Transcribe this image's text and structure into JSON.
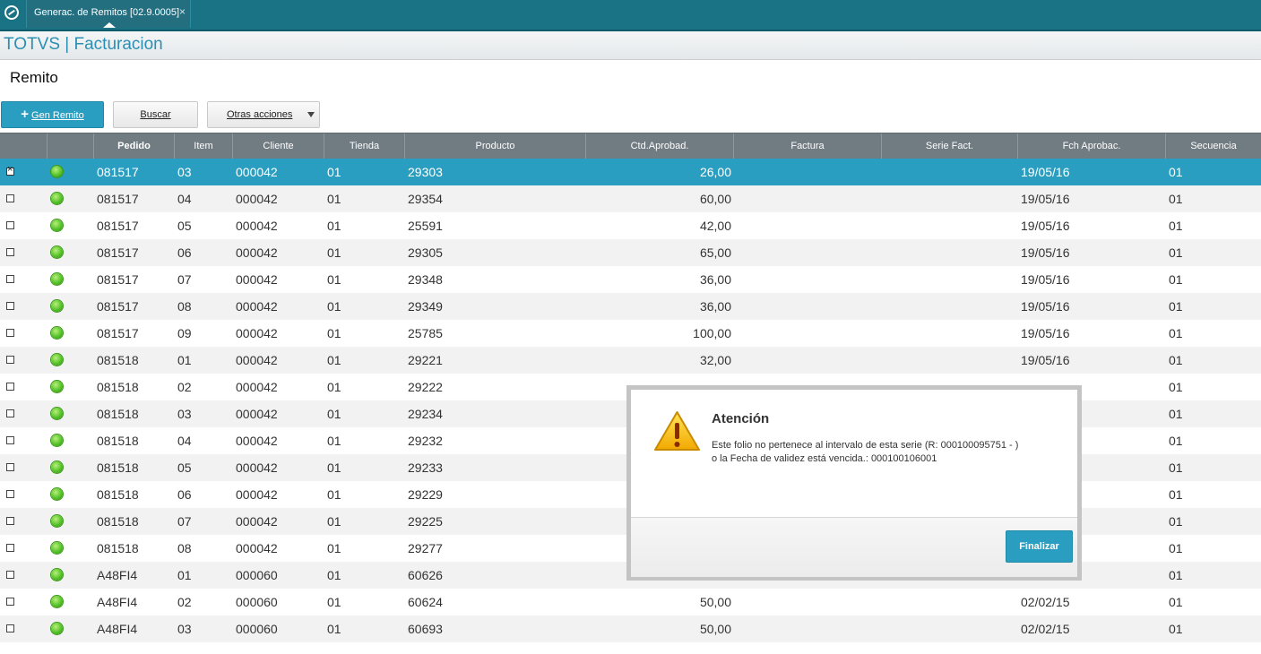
{
  "window": {
    "tab_label": "Generac. de Remitos [02.9.0005]",
    "tab_close": "×",
    "app_title": "TOTVS | Facturacion"
  },
  "page": {
    "title": "Remito"
  },
  "toolbar": {
    "gen_remito": "Gen Remito",
    "gen_remito_plus": "+",
    "buscar": "Buscar",
    "otras_acciones": "Otras acciones"
  },
  "grid": {
    "columns": [
      "",
      "",
      "Pedido",
      "Item",
      "Cliente",
      "Tienda",
      "Producto",
      "Ctd.Aprobad.",
      "Factura",
      "Serie Fact.",
      "Fch Aprobac.",
      "Secuencia"
    ],
    "rows": [
      {
        "pedido": "081517",
        "item": "03",
        "cliente": "000042",
        "tienda": "01",
        "producto": "29303",
        "ctd": "26,00",
        "factura": "",
        "serie": "",
        "fecha": "19/05/16",
        "secuencia": "01"
      },
      {
        "pedido": "081517",
        "item": "04",
        "cliente": "000042",
        "tienda": "01",
        "producto": "29354",
        "ctd": "60,00",
        "factura": "",
        "serie": "",
        "fecha": "19/05/16",
        "secuencia": "01"
      },
      {
        "pedido": "081517",
        "item": "05",
        "cliente": "000042",
        "tienda": "01",
        "producto": "25591",
        "ctd": "42,00",
        "factura": "",
        "serie": "",
        "fecha": "19/05/16",
        "secuencia": "01"
      },
      {
        "pedido": "081517",
        "item": "06",
        "cliente": "000042",
        "tienda": "01",
        "producto": "29305",
        "ctd": "65,00",
        "factura": "",
        "serie": "",
        "fecha": "19/05/16",
        "secuencia": "01"
      },
      {
        "pedido": "081517",
        "item": "07",
        "cliente": "000042",
        "tienda": "01",
        "producto": "29348",
        "ctd": "36,00",
        "factura": "",
        "serie": "",
        "fecha": "19/05/16",
        "secuencia": "01"
      },
      {
        "pedido": "081517",
        "item": "08",
        "cliente": "000042",
        "tienda": "01",
        "producto": "29349",
        "ctd": "36,00",
        "factura": "",
        "serie": "",
        "fecha": "19/05/16",
        "secuencia": "01"
      },
      {
        "pedido": "081517",
        "item": "09",
        "cliente": "000042",
        "tienda": "01",
        "producto": "25785",
        "ctd": "100,00",
        "factura": "",
        "serie": "",
        "fecha": "19/05/16",
        "secuencia": "01"
      },
      {
        "pedido": "081518",
        "item": "01",
        "cliente": "000042",
        "tienda": "01",
        "producto": "29221",
        "ctd": "32,00",
        "factura": "",
        "serie": "",
        "fecha": "19/05/16",
        "secuencia": "01"
      },
      {
        "pedido": "081518",
        "item": "02",
        "cliente": "000042",
        "tienda": "01",
        "producto": "29222",
        "ctd": "",
        "factura": "",
        "serie": "",
        "fecha": "",
        "secuencia": "01"
      },
      {
        "pedido": "081518",
        "item": "03",
        "cliente": "000042",
        "tienda": "01",
        "producto": "29234",
        "ctd": "",
        "factura": "",
        "serie": "",
        "fecha": "",
        "secuencia": "01"
      },
      {
        "pedido": "081518",
        "item": "04",
        "cliente": "000042",
        "tienda": "01",
        "producto": "29232",
        "ctd": "",
        "factura": "",
        "serie": "",
        "fecha": "",
        "secuencia": "01"
      },
      {
        "pedido": "081518",
        "item": "05",
        "cliente": "000042",
        "tienda": "01",
        "producto": "29233",
        "ctd": "",
        "factura": "",
        "serie": "",
        "fecha": "",
        "secuencia": "01"
      },
      {
        "pedido": "081518",
        "item": "06",
        "cliente": "000042",
        "tienda": "01",
        "producto": "29229",
        "ctd": "",
        "factura": "",
        "serie": "",
        "fecha": "",
        "secuencia": "01"
      },
      {
        "pedido": "081518",
        "item": "07",
        "cliente": "000042",
        "tienda": "01",
        "producto": "29225",
        "ctd": "",
        "factura": "",
        "serie": "",
        "fecha": "",
        "secuencia": "01"
      },
      {
        "pedido": "081518",
        "item": "08",
        "cliente": "000042",
        "tienda": "01",
        "producto": "29277",
        "ctd": "",
        "factura": "",
        "serie": "",
        "fecha": "",
        "secuencia": "01"
      },
      {
        "pedido": "A48FI4",
        "item": "01",
        "cliente": "000060",
        "tienda": "01",
        "producto": "60626",
        "ctd": "",
        "factura": "",
        "serie": "",
        "fecha": "",
        "secuencia": "01"
      },
      {
        "pedido": "A48FI4",
        "item": "02",
        "cliente": "000060",
        "tienda": "01",
        "producto": "60624",
        "ctd": "50,00",
        "factura": "",
        "serie": "",
        "fecha": "02/02/15",
        "secuencia": "01"
      },
      {
        "pedido": "A48FI4",
        "item": "03",
        "cliente": "000060",
        "tienda": "01",
        "producto": "60693",
        "ctd": "50,00",
        "factura": "",
        "serie": "",
        "fecha": "02/02/15",
        "secuencia": "01"
      }
    ],
    "selected_row": 0,
    "status_color": "#56c22a",
    "selected_color": "#2a9ec0"
  },
  "dialog": {
    "title": "Atención",
    "message_line1": "Este folio no pertenece al intervalo de esta serie (R: 000100095751 - )",
    "message_line2": "o la Fecha de validez está vencida.: 000100106001",
    "button": "Finalizar",
    "icon": "warning-icon"
  }
}
